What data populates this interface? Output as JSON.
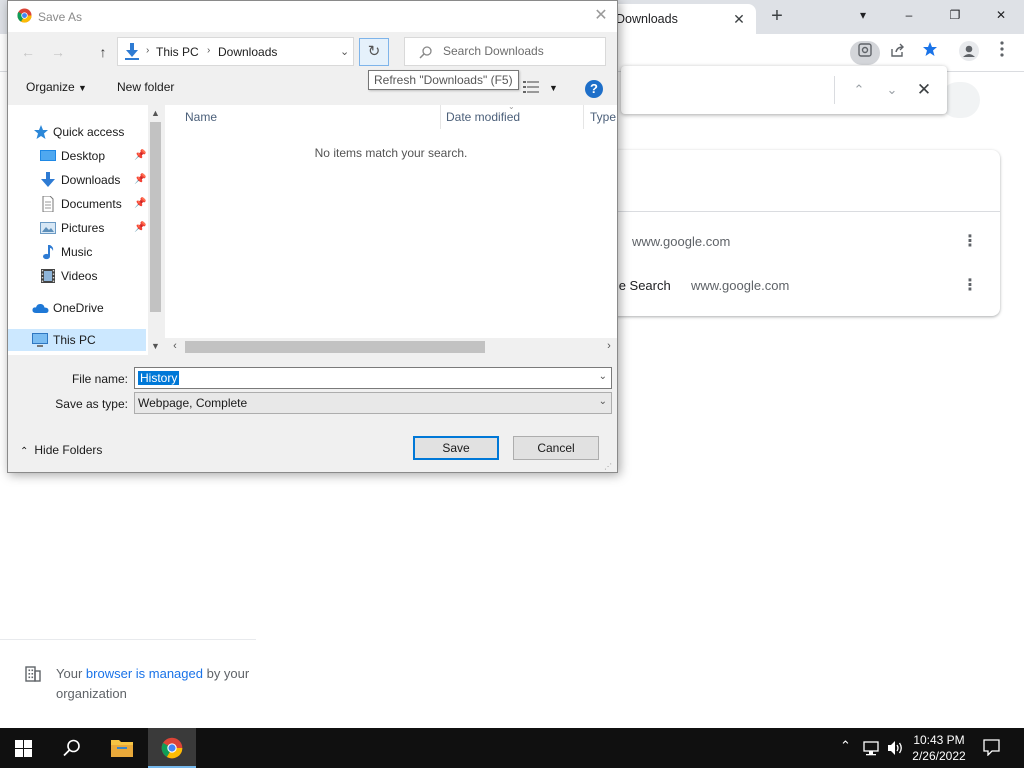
{
  "browser": {
    "tab_title": "Downloads",
    "window_controls": [
      "▾",
      "–",
      "❐",
      "✕"
    ],
    "history": {
      "rows": [
        {
          "title": "",
          "url": "www.google.com"
        },
        {
          "title": "Google Search",
          "url": "www.google.com"
        }
      ]
    },
    "managed": {
      "prefix": "Your",
      "link": "browser is managed",
      "suffix": "by your organization"
    }
  },
  "dialog": {
    "title": "Save As",
    "address": {
      "root": "This PC",
      "folder": "Downloads"
    },
    "search_placeholder": "Search Downloads",
    "refresh_tooltip": "Refresh \"Downloads\" (F5)",
    "toolbar": {
      "organize": "Organize",
      "new_folder": "New folder",
      "help": "?"
    },
    "nav": [
      {
        "label": "Quick access",
        "icon": "star-icon",
        "level": 0,
        "pinned": false
      },
      {
        "label": "Desktop",
        "icon": "desktop-icon",
        "level": 1,
        "pinned": true
      },
      {
        "label": "Downloads",
        "icon": "download-arrow-icon",
        "level": 1,
        "pinned": true
      },
      {
        "label": "Documents",
        "icon": "document-icon",
        "level": 1,
        "pinned": true
      },
      {
        "label": "Pictures",
        "icon": "pictures-icon",
        "level": 1,
        "pinned": true
      },
      {
        "label": "Music",
        "icon": "music-note-icon",
        "level": 1,
        "pinned": false
      },
      {
        "label": "Videos",
        "icon": "film-icon",
        "level": 1,
        "pinned": false
      },
      {
        "label": "OneDrive",
        "icon": "cloud-icon",
        "level": 0,
        "pinned": false
      },
      {
        "label": "This PC",
        "icon": "computer-icon",
        "level": 0,
        "pinned": false
      }
    ],
    "columns": [
      "Name",
      "Date modified",
      "Type"
    ],
    "empty_message": "No items match your search.",
    "file_name_label": "File name:",
    "file_name_value": "History",
    "save_type_label": "Save as type:",
    "save_type_value": "Webpage, Complete",
    "hide_folders": "Hide Folders",
    "save_button": "Save",
    "cancel_button": "Cancel"
  },
  "taskbar": {
    "time": "10:43 PM",
    "date": "2/26/2022"
  },
  "colors": {
    "accent": "#0078d7",
    "chrome_blue": "#1a73e8",
    "taskbar": "#101010"
  }
}
